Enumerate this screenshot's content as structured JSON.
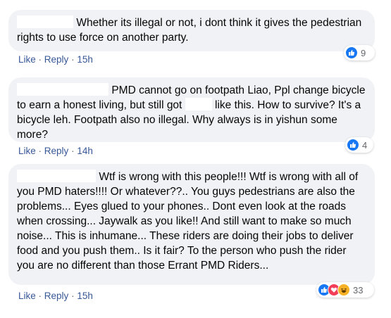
{
  "colors": {
    "bubble": "#f0f2f5",
    "link": "#385898",
    "meta": "#65676b",
    "like_blue": "#1877f2",
    "love_red": "#f33e58",
    "haha_yellow": "#f7b125"
  },
  "comments": [
    {
      "text": "Whether its illegal or not, i dont think it gives the pedestrian rights to use force on another party.",
      "like_label": "Like",
      "reply_label": "Reply",
      "separator": "·",
      "time": "15h",
      "reactions": [
        "like-icon"
      ],
      "reaction_count": "9"
    },
    {
      "text_part1": "PMD cannot go on footpath Liao, Ppl change bicycle to earn a honest living, but still got",
      "text_part2": "like this. How to survive? It's a bicycle leh. Footpath also no illegal. Why always is in yishun some more?",
      "like_label": "Like",
      "reply_label": "Reply",
      "separator": "·",
      "time": "14h",
      "reactions": [
        "like-icon"
      ],
      "reaction_count": "4"
    },
    {
      "text": "Wtf is wrong with this people!!! Wtf is wrong with all of you PMD haters!!!! Or whatever??.. You guys pedestrians are also the problems... Eyes glued to your phones.. Dont even look at the roads when crossing... Jaywalk as you like!! And still want to make so much noise... This is inhumane... These riders are doing their jobs to deliver food and you push them.. Is it fair? To the person who push the rider you are no different than those Errant PMD Riders...",
      "like_label": "Like",
      "reply_label": "Reply",
      "separator": "·",
      "time": "15h",
      "reactions": [
        "like-icon",
        "love-icon",
        "haha-icon"
      ],
      "reaction_count": "33"
    }
  ]
}
